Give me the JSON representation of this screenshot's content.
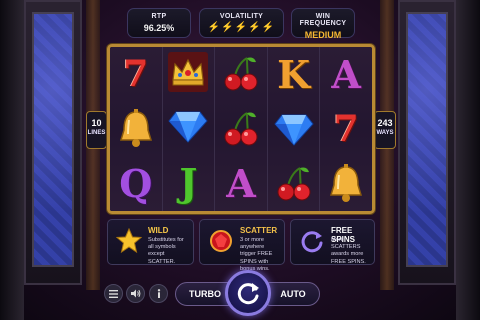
{
  "stats": {
    "rtp_label": "RTP",
    "rtp_value": "96.25%",
    "volatility_label": "VOLATILITY",
    "volatility_level": 4,
    "volatility_max": 5,
    "frequency_label": "WIN FREQUENCY",
    "frequency_value": "MEDIUM"
  },
  "side": {
    "lines_value": "10",
    "lines_label": "LINES",
    "ways_value": "243",
    "ways_label": "WAYS"
  },
  "reels": [
    [
      {
        "symbol": "seven",
        "text": "7"
      },
      {
        "symbol": "bell-icon"
      },
      {
        "symbol": "letter-q",
        "text": "Q"
      }
    ],
    [
      {
        "symbol": "crown-icon"
      },
      {
        "symbol": "diamond-icon"
      },
      {
        "symbol": "letter-j",
        "text": "J"
      }
    ],
    [
      {
        "symbol": "cherries-icon"
      },
      {
        "symbol": "cherries-icon"
      },
      {
        "symbol": "letter-a",
        "text": "A"
      }
    ],
    [
      {
        "symbol": "letter-k",
        "text": "K"
      },
      {
        "symbol": "diamond-icon"
      },
      {
        "symbol": "cherries-icon"
      }
    ],
    [
      {
        "symbol": "letter-a",
        "text": "A"
      },
      {
        "symbol": "seven",
        "text": "7"
      },
      {
        "symbol": "bell-icon"
      }
    ]
  ],
  "panels": {
    "wild": {
      "title": "WILD",
      "desc": "Substitutes for all symbols except SCATTER."
    },
    "scatter": {
      "title": "SCATTER",
      "desc": "3 or more anywhere trigger FREE SPINS with bonus wins."
    },
    "free": {
      "title": "FREE SPINS",
      "desc": "More SCATTERS awards more FREE SPINS."
    }
  },
  "controls": {
    "turbo_label": "TURBO",
    "auto_label": "AUTO"
  },
  "colors": {
    "gold": "#f7c948",
    "frame": "#b98a34",
    "spin_ring": "#8a7be0"
  }
}
